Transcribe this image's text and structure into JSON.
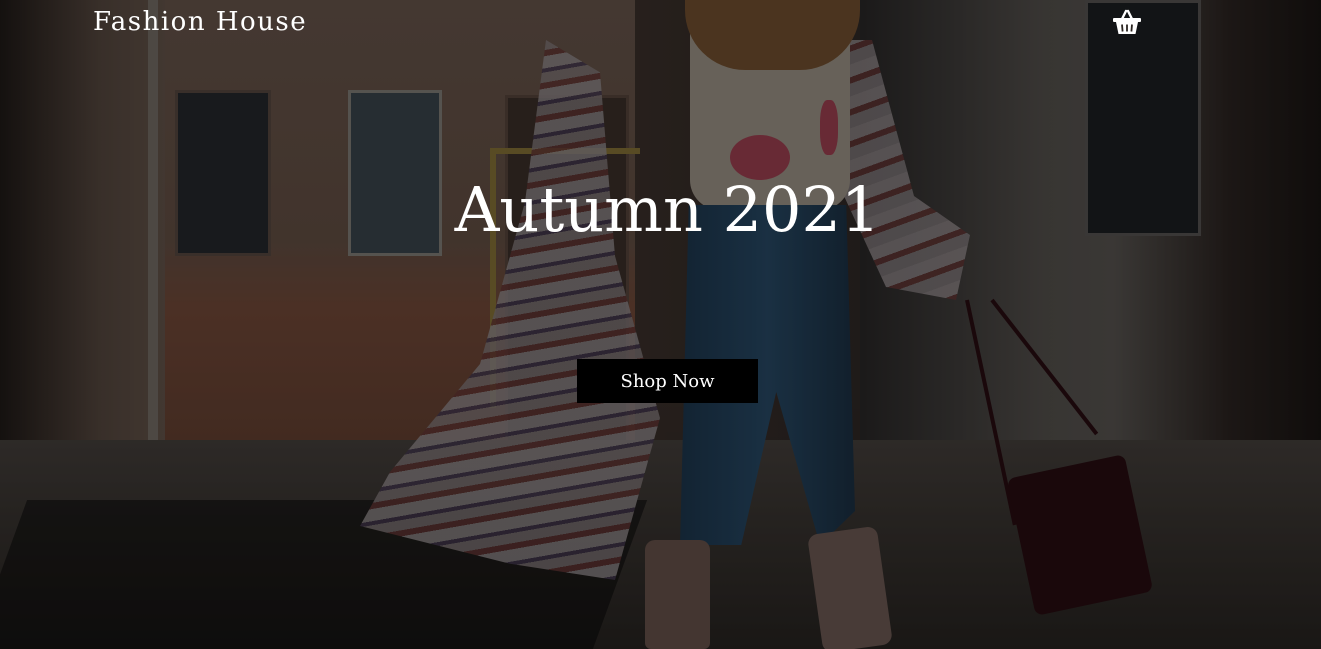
{
  "header": {
    "brand": "Fashion House",
    "cart_icon": "basket-icon"
  },
  "hero": {
    "title": "Autumn 2021",
    "cta_label": "Shop Now"
  },
  "colors": {
    "text": "#ffffff",
    "button_bg": "#000000",
    "overlay": "rgba(0,0,0,0.38)"
  }
}
